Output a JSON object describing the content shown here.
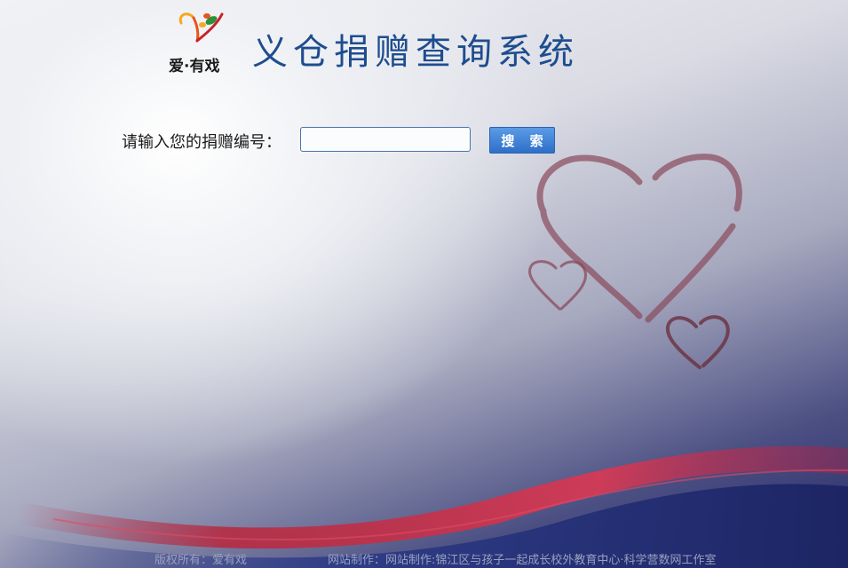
{
  "brand": {
    "logo_text": "爱·有戏",
    "logo_colors": [
      "#e8541d",
      "#f6a81f",
      "#c8202a",
      "#2d8f3a"
    ]
  },
  "title": "义仓捐赠查询系统",
  "search": {
    "label": "请输入您的捐赠编号：",
    "value": "",
    "placeholder": "",
    "button_label": "搜 索"
  },
  "footer": {
    "copyright": "版权所有：爱有戏",
    "credit": "网站制作：网站制作:锦江区与孩子一起成长校外教育中心·科学营数网工作室"
  },
  "colors": {
    "title": "#1e4d8f",
    "button": "#3b7fd4",
    "heart": "#8a4a5c",
    "ribbon": "#c0283e"
  },
  "icons": [
    "logo-heart-icon",
    "large-heart-icon",
    "small-heart-left-icon",
    "small-heart-right-icon"
  ]
}
